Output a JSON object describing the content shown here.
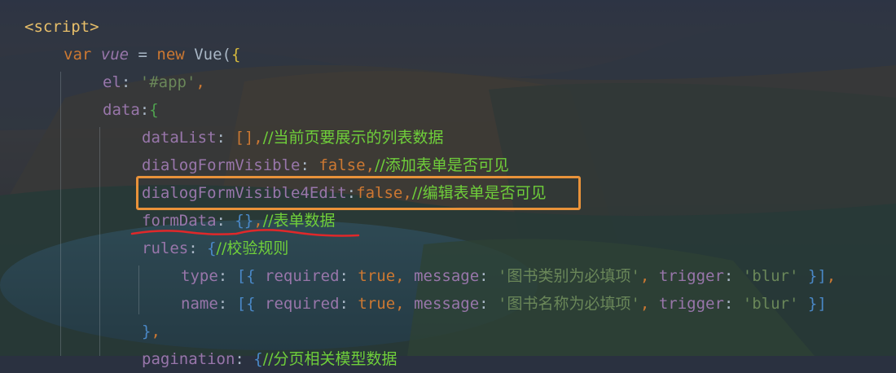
{
  "code_lines": [
    {
      "id": "l1",
      "tokens": [
        {
          "t": "<script>",
          "c": "tag"
        }
      ]
    },
    {
      "id": "l2",
      "tokens": [
        {
          "t": "var ",
          "c": "kw"
        },
        {
          "t": "vue",
          "c": "var-ital"
        },
        {
          "t": " = ",
          "c": "plain"
        },
        {
          "t": "new ",
          "c": "kw"
        },
        {
          "t": "Vue",
          "c": "plain"
        },
        {
          "t": "(",
          "c": "plain"
        },
        {
          "t": "{",
          "c": "bracket-gold"
        }
      ]
    },
    {
      "id": "l3",
      "tokens": [
        {
          "t": "el",
          "c": "prop"
        },
        {
          "t": ": ",
          "c": "plain"
        },
        {
          "t": "'#app'",
          "c": "str"
        },
        {
          "t": ",",
          "c": "kw"
        }
      ]
    },
    {
      "id": "l4",
      "tokens": [
        {
          "t": "data",
          "c": "prop"
        },
        {
          "t": ":",
          "c": "plain"
        },
        {
          "t": "{",
          "c": "bracket-green"
        }
      ]
    },
    {
      "id": "l5",
      "tokens": [
        {
          "t": "dataList",
          "c": "prop"
        },
        {
          "t": ": ",
          "c": "plain"
        },
        {
          "t": "[]",
          "c": "kw"
        },
        {
          "t": ",",
          "c": "kw"
        },
        {
          "t": "//当前页要展示的列表数据",
          "c": "comment"
        }
      ]
    },
    {
      "id": "l6",
      "tokens": [
        {
          "t": "dialogFormVisible",
          "c": "prop"
        },
        {
          "t": ": ",
          "c": "plain"
        },
        {
          "t": "false",
          "c": "kw"
        },
        {
          "t": ",",
          "c": "kw"
        },
        {
          "t": "//添加表单是否可见",
          "c": "comment"
        }
      ]
    },
    {
      "id": "l7",
      "tokens": [
        {
          "t": "dialogFormVisible4Edit",
          "c": "prop"
        },
        {
          "t": ":",
          "c": "plain"
        },
        {
          "t": "false",
          "c": "kw"
        },
        {
          "t": ",",
          "c": "kw"
        },
        {
          "t": "//编辑表单是否可见",
          "c": "comment"
        }
      ]
    },
    {
      "id": "l8",
      "tokens": [
        {
          "t": "formData",
          "c": "prop"
        },
        {
          "t": ": ",
          "c": "plain"
        },
        {
          "t": "{}",
          "c": "bracket-blue"
        },
        {
          "t": ",",
          "c": "kw"
        },
        {
          "t": "//表单数据",
          "c": "comment"
        }
      ]
    },
    {
      "id": "l9",
      "tokens": [
        {
          "t": "rules",
          "c": "prop"
        },
        {
          "t": ": ",
          "c": "plain"
        },
        {
          "t": "{",
          "c": "bracket-blue"
        },
        {
          "t": "//校验规则",
          "c": "comment"
        }
      ]
    },
    {
      "id": "l10",
      "tokens": [
        {
          "t": "type",
          "c": "prop"
        },
        {
          "t": ": ",
          "c": "plain"
        },
        {
          "t": "[",
          "c": "bracket-blue"
        },
        {
          "t": "{ ",
          "c": "bracket-blue"
        },
        {
          "t": "required",
          "c": "prop"
        },
        {
          "t": ": ",
          "c": "plain"
        },
        {
          "t": "true",
          "c": "kw"
        },
        {
          "t": ", ",
          "c": "kw"
        },
        {
          "t": "message",
          "c": "prop"
        },
        {
          "t": ": ",
          "c": "plain"
        },
        {
          "t": "'图书类别为必填项'",
          "c": "str"
        },
        {
          "t": ", ",
          "c": "kw"
        },
        {
          "t": "trigger",
          "c": "prop"
        },
        {
          "t": ": ",
          "c": "plain"
        },
        {
          "t": "'blur'",
          "c": "str"
        },
        {
          "t": " }",
          "c": "bracket-blue"
        },
        {
          "t": "]",
          "c": "bracket-blue"
        },
        {
          "t": ",",
          "c": "kw"
        }
      ]
    },
    {
      "id": "l11",
      "tokens": [
        {
          "t": "name",
          "c": "prop"
        },
        {
          "t": ": ",
          "c": "plain"
        },
        {
          "t": "[",
          "c": "bracket-blue"
        },
        {
          "t": "{ ",
          "c": "bracket-blue"
        },
        {
          "t": "required",
          "c": "prop"
        },
        {
          "t": ": ",
          "c": "plain"
        },
        {
          "t": "true",
          "c": "kw"
        },
        {
          "t": ", ",
          "c": "kw"
        },
        {
          "t": "message",
          "c": "prop"
        },
        {
          "t": ": ",
          "c": "plain"
        },
        {
          "t": "'图书名称为必填项'",
          "c": "str"
        },
        {
          "t": ", ",
          "c": "kw"
        },
        {
          "t": "trigger",
          "c": "prop"
        },
        {
          "t": ": ",
          "c": "plain"
        },
        {
          "t": "'blur'",
          "c": "str"
        },
        {
          "t": " }",
          "c": "bracket-blue"
        },
        {
          "t": "]",
          "c": "bracket-blue"
        }
      ]
    },
    {
      "id": "l12",
      "tokens": [
        {
          "t": "}",
          "c": "bracket-blue"
        },
        {
          "t": ",",
          "c": "kw"
        }
      ]
    },
    {
      "id": "l13",
      "tokens": [
        {
          "t": "pagination",
          "c": "prop"
        },
        {
          "t": ": ",
          "c": "plain"
        },
        {
          "t": "{",
          "c": "bracket-blue"
        },
        {
          "t": "//分页相关模型数据",
          "c": "comment"
        }
      ]
    }
  ],
  "annotations": {
    "highlight_box_color": "#e8923a",
    "underline_color": "#e0282a"
  },
  "theme": {
    "keyword": "#cc7832",
    "property": "#9876aa",
    "string": "#6a8759",
    "comment": "#6fcf3a",
    "tag": "#e8bf6a"
  }
}
